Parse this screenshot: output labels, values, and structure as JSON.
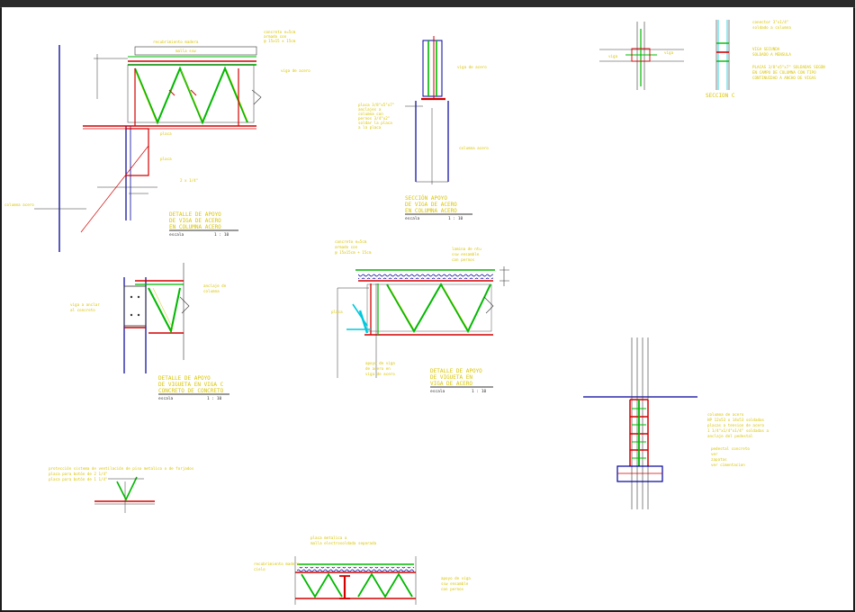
{
  "colors": {
    "beam": "#d40000",
    "column": "#00009a",
    "truss": "#00b800",
    "text": "#d8c400",
    "line": "#555555",
    "cyan": "#00c8dc"
  },
  "labels": {
    "d1_a": "recubrimiento madera",
    "d1_b": "malla ssw",
    "d1_c": "concreto e=5cm",
    "d1_d": "armado con",
    "d1_e": "@ 15x15 x 15cm",
    "d1_f": "viga de acero",
    "d1_g": "placa",
    "d1_h": "placa",
    "d1_i": "2 x 1/4\"",
    "d1_j": "columna acero",
    "d2_a": "viga de acero",
    "d2_b": "placa 3/8\"x5\"x7\"",
    "d2_c": "anclajes a",
    "d2_d": "columna con",
    "d2_e": "pernos 3/4\"x2\"",
    "d2_f": "soldar la placa",
    "d2_g": "a la placa",
    "d2_h": "columna acero",
    "d3_a": "conector 3\"x1/4\"",
    "d3_b": "soldado a columna",
    "d3_c": "viga",
    "d3_d": "viga",
    "d3_e": "VIGA SECUNDA",
    "d3_f": "SOLDADO A MENSULA",
    "d3_g": "PLACAS 3/8\"x5\"x7\" SOLDADAS SEGÚN",
    "d3_h": "EN CAMPO DE COLUMNA CON TIPO",
    "d3_i": "CONTINUIDAD A ANCHO DE VIGAS",
    "d3_j": "SECCION C",
    "d4_a": "viga a anclar",
    "d4_b": "al concreto",
    "d4_c": "anclaje de",
    "d4_d": "columna",
    "d5_a": "concreto e=5cm",
    "d5_b": "armado con",
    "d5_c": "@ 15x15cm + 15cm",
    "d5_d": "lamina de ntu",
    "d5_e": "ssw ensamble",
    "d5_f": "con pernos",
    "d5_g": "apoyo de viga",
    "d5_h": "de acero en",
    "d5_i": "viga de acero",
    "d5_j": "placa",
    "d6_a": "columna de acero",
    "d6_b": "HP 12x53 o 14x53 soldadas",
    "d6_c": "placas a tension de acero",
    "d6_d": "1 1/4\"x1/4\"x1/4\" soldadas a",
    "d6_e": "anclaje del pedestal",
    "d6_f": "pedestal concreto",
    "d6_g": "ver",
    "d6_h": "zapatas",
    "d6_i": "ver cimentacion",
    "d7_a": "protección sistema de ventilación de piso metalico o de forjados",
    "d7_b": "placa para botón de 2 1/4\"",
    "d7_c": "placa para botón de 1 1/4\"",
    "d8_a": "placa metalica a",
    "d8_b": "malla electrosoldada separada",
    "d8_c": "recubrimiento madera",
    "d8_d": "cielo",
    "d8_e": "apoyo de viga",
    "d8_f": "ssw ensamble",
    "d8_g": "con pernos"
  },
  "titles": {
    "t1": [
      "DETALLE DE APOYO",
      "DE VIGA DE ACERO",
      "EN COLUMNA ACERO"
    ],
    "t2": [
      "SECCIÓN APOYO",
      "DE VIGA DE ACERO",
      "EN COLUMNA ACERO"
    ],
    "t3": [
      "DETALLE DE APOYO",
      "DE VIGUETA EN VIGA C",
      "CONCRETO DE CONCRETO"
    ],
    "t4": [
      "DETALLE DE APOYO",
      "DE VIGUETA EN",
      "VIGA DE ACERO"
    ]
  },
  "scales": {
    "s_label": "escala",
    "s_value": "1 : 10"
  }
}
